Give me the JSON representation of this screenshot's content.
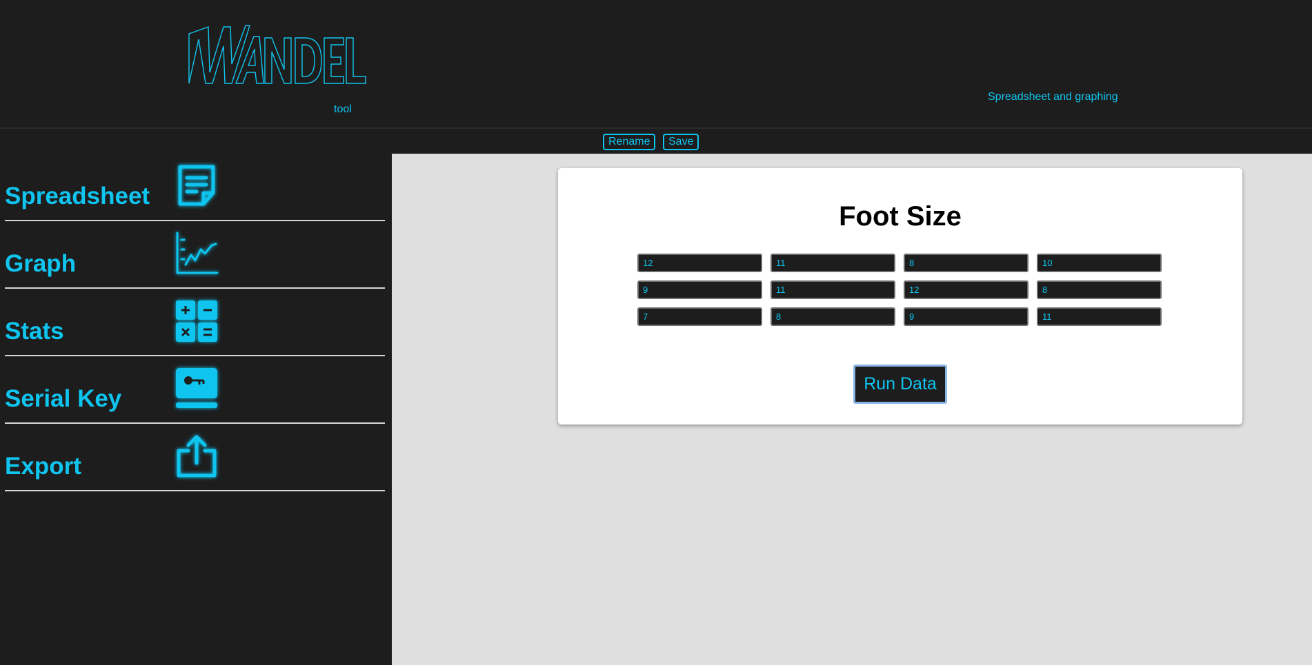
{
  "header": {
    "logo_text": "WANDEL",
    "logo_sub": "tool",
    "tagline": "Spreadsheet and graphing"
  },
  "toolbar": {
    "rename_label": "Rename",
    "save_label": "Save"
  },
  "sidebar": {
    "items": [
      {
        "label": "Spreadsheet",
        "icon": "note-icon"
      },
      {
        "label": "Graph",
        "icon": "line-chart-icon"
      },
      {
        "label": "Stats",
        "icon": "calculator-icon"
      },
      {
        "label": "Serial Key",
        "icon": "key-card-icon"
      },
      {
        "label": "Export",
        "icon": "share-export-icon"
      }
    ]
  },
  "main": {
    "title": "Foot Size",
    "cells": [
      [
        "12",
        "11",
        "8",
        "10"
      ],
      [
        "9",
        "11",
        "12",
        "8"
      ],
      [
        "7",
        "8",
        "9",
        "11"
      ]
    ],
    "run_label": "Run Data"
  },
  "colors": {
    "accent": "#0fc5f0",
    "background": "#1d1d1d",
    "main_background": "#dfdfdf",
    "card": "#ffffff"
  }
}
